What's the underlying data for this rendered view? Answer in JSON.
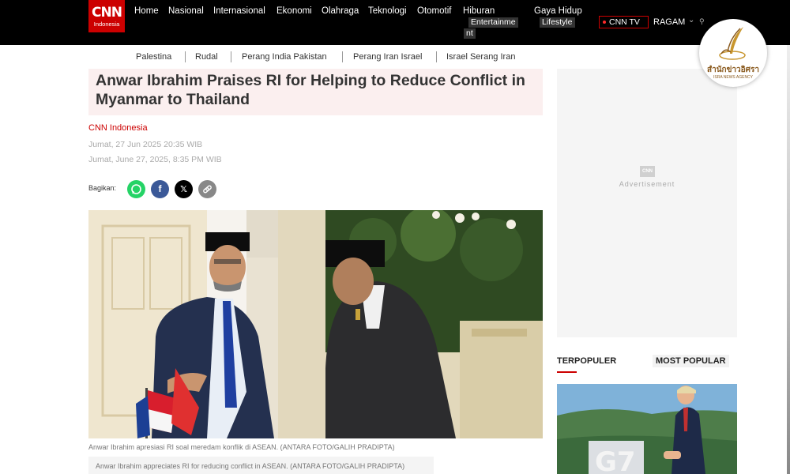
{
  "header": {
    "logo_top": "CNN",
    "logo_bottom": "Indonesia",
    "nav": [
      {
        "label": "Home"
      },
      {
        "label": "Nasional"
      },
      {
        "label": "Internasional"
      },
      {
        "label": "Ekonomi"
      },
      {
        "label": "Olahraga"
      },
      {
        "label": "Teknologi"
      },
      {
        "label": "Otomotif"
      },
      {
        "label": "Hiburan"
      },
      {
        "label": "Gaya Hidup"
      }
    ],
    "hiburan_sub_1": "Entertainme",
    "hiburan_sub_2": "nt",
    "gaya_sub": "Lifestyle",
    "cnn_tv": "CNN TV",
    "ragam": "RAGAM"
  },
  "watermark": {
    "title": "สำนักข่าวอิศรา",
    "subtitle": "ISRA NEWS AGENCY"
  },
  "subnav": [
    "Palestina",
    "Rudal",
    "Perang India Pakistan",
    "Perang Iran Israel",
    "Israel Serang Iran"
  ],
  "article": {
    "headline": "Anwar Ibrahim Praises RI for Helping to Reduce Conflict in Myanmar to Thailand",
    "source": "CNN Indonesia",
    "date_id": "Jumat, 27 Jun 2025 20:35 WIB",
    "date_en": "Jumat, June 27, 2025, 8:35 PM WIB",
    "share_label": "Bagikan:",
    "caption_id": "Anwar Ibrahim apresiasi RI soal meredam konflik di ASEAN. (ANTARA FOTO/GALIH PRADIPTA)",
    "caption_en": "Anwar Ibrahim appreciates RI for reducing conflict in ASEAN. (ANTARA FOTO/GALIH PRADIPTA)"
  },
  "sidebar": {
    "ad_logo": "CNN",
    "ad_text": "Advertisement",
    "tab_1": "TERPOPULER",
    "tab_2": "MOST POPULAR",
    "photo_sign": "G7"
  },
  "colors": {
    "brand_red": "#cc0000",
    "whatsapp": "#25d366",
    "facebook": "#3b5998",
    "x": "#000000",
    "link": "#888888"
  },
  "icons": [
    "whatsapp-icon",
    "facebook-icon",
    "x-icon",
    "link-icon",
    "search-icon",
    "chevron-down-icon"
  ]
}
